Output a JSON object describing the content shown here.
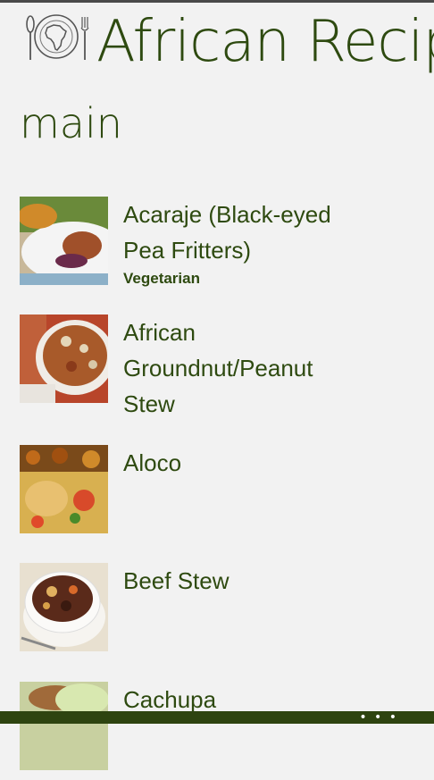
{
  "header": {
    "app_title": "African Recip",
    "page_title": "main"
  },
  "recipes": [
    {
      "title_lines": [
        "Acaraje (Black-eyed",
        "Pea Fritters)"
      ],
      "category": "Vegetarian",
      "image_icon": "acaraje-photo"
    },
    {
      "title_lines": [
        "African",
        "Groundnut/Peanut",
        "Stew"
      ],
      "category": "",
      "image_icon": "groundnut-stew-photo"
    },
    {
      "title_lines": [
        "Aloco"
      ],
      "category": "",
      "image_icon": "aloco-photo"
    },
    {
      "title_lines": [
        "Beef Stew"
      ],
      "category": "",
      "image_icon": "beef-stew-photo"
    },
    {
      "title_lines": [
        "Cachupa"
      ],
      "category": "",
      "image_icon": "cachupa-photo"
    }
  ],
  "appbar": {
    "more_label": "• • •"
  },
  "colors": {
    "accent": "#2e4a10",
    "background": "#f2f2f2",
    "appbar": "#2e4410"
  }
}
